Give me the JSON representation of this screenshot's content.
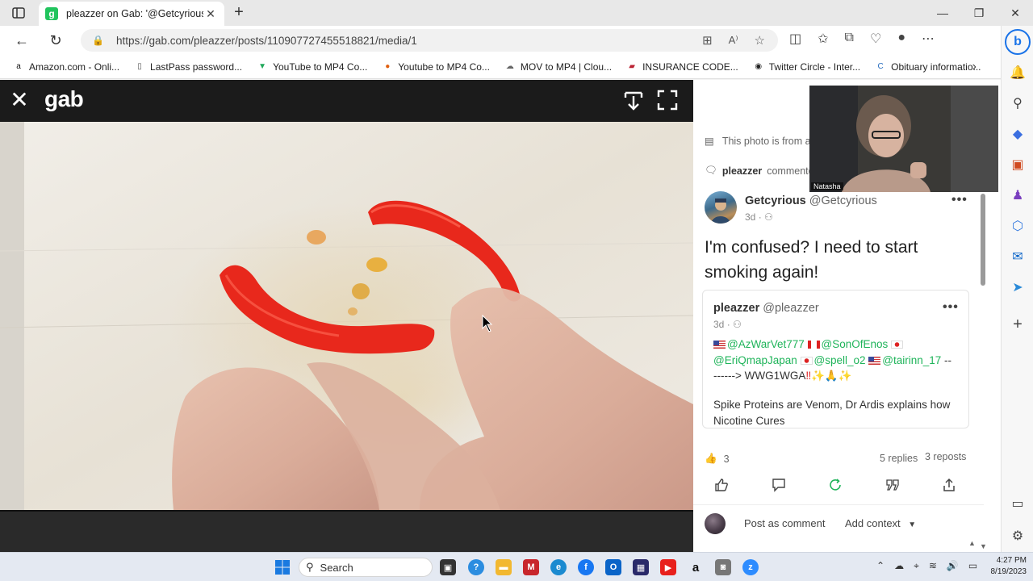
{
  "browser": {
    "tab_title": "pleazzer on Gab: '@Getcyrious H",
    "url": "https://gab.com/pleazzer/posts/110907727455518821/media/1",
    "bookmarks": [
      {
        "label": "Amazon.com - Onli...",
        "icon": "amazon-icon",
        "color": "#111111"
      },
      {
        "label": "LastPass password...",
        "icon": "document-icon",
        "color": "#555555"
      },
      {
        "label": "YouTube to MP4 Co...",
        "icon": "triangle-icon",
        "color": "#1fa85a"
      },
      {
        "label": "Youtube to MP4 Co...",
        "icon": "circle-play-icon",
        "color": "#e06010"
      },
      {
        "label": "MOV to MP4 | Clou...",
        "icon": "cloud-icon",
        "color": "#666666"
      },
      {
        "label": "INSURANCE CODE...",
        "icon": "texas-flag-icon",
        "color": "#bb2233"
      },
      {
        "label": "Twitter Circle - Inter...",
        "icon": "twitter-circle-icon",
        "color": "#222222"
      },
      {
        "label": "Obituary informatio...",
        "icon": "c-icon",
        "color": "#2a6fc0"
      }
    ]
  },
  "viewer": {
    "logo": "gab"
  },
  "panel": {
    "notice": "This photo is from a",
    "commented_user": "pleazzer",
    "commented_text": "commented",
    "post": {
      "display_name": "Getcyrious",
      "handle": "@Getcyrious",
      "time": "3d",
      "text": "I'm confused? I need to start smoking again!"
    },
    "quoted": {
      "display_name": "pleazzer",
      "handle": "@pleazzer",
      "time": "3d",
      "mentions": [
        "@AzWarVet777",
        "@SonOfEnos",
        "@EriQmapJapan",
        "@spell_o2",
        "@tairinn_17"
      ],
      "arrow_text": "--",
      "arrow_text2": "------> WWG1WGA",
      "emojis": "‼✨🙏✨",
      "body": "Spike Proteins are Venom, Dr Ardis explains how Nicotine Cures"
    },
    "stats": {
      "likes": "3",
      "replies": "5 replies",
      "reposts": "3 reposts"
    },
    "comment_box": {
      "post_label": "Post as comment",
      "context_label": "Add context"
    }
  },
  "webcam": {
    "name": "Natasha"
  },
  "taskbar": {
    "search": "Search",
    "time": "4:27 PM",
    "date": "8/19/2023"
  },
  "colors": {
    "gab_green": "#21c45d",
    "viewer_bg": "#1b1b1b",
    "mention": "#1fb45a",
    "pepper_red": "#e8281c"
  }
}
